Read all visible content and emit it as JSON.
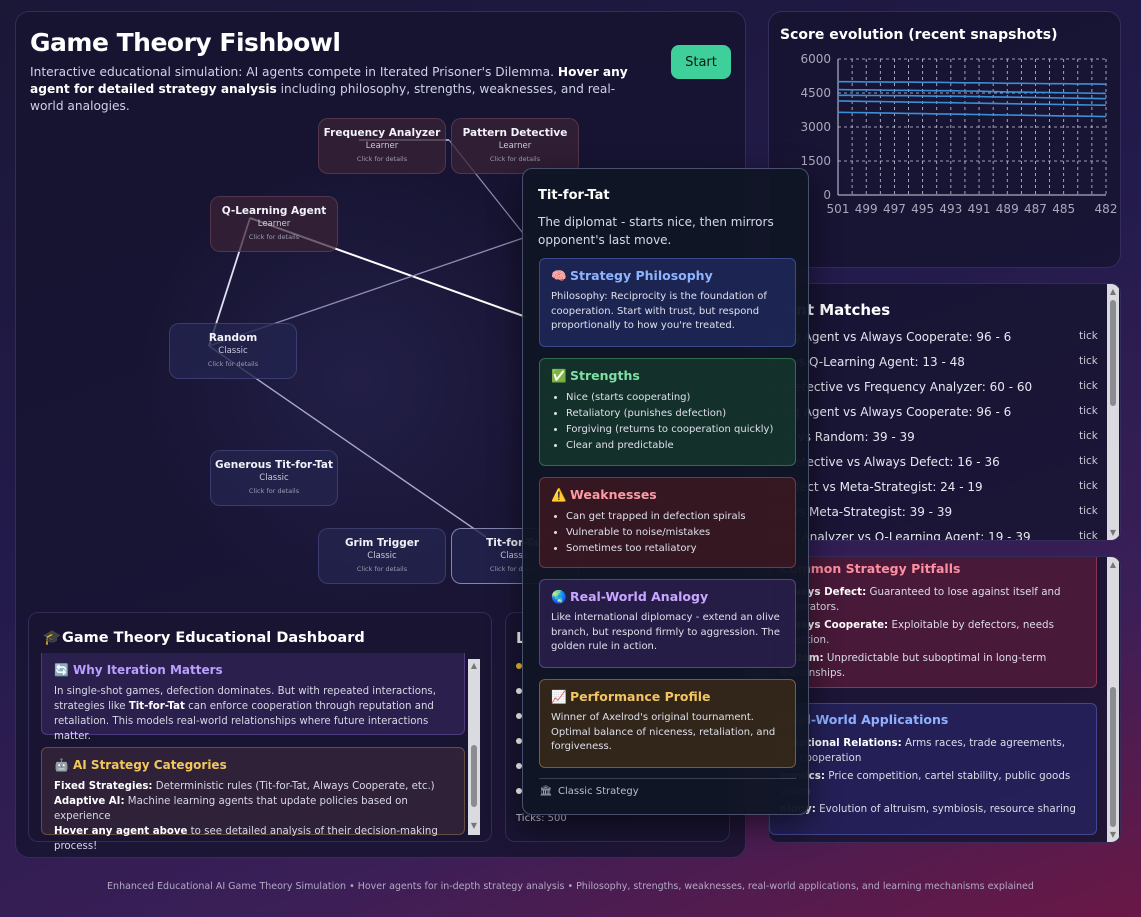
{
  "header": {
    "title": "Game Theory Fishbowl",
    "subtitle_plain": "Interactive educational simulation: AI agents compete in Iterated Prisoner's Dilemma. ",
    "subtitle_bold": "Hover any agent for detailed strategy analysis",
    "subtitle_tail": " including philosophy, strengths, weaknesses, and real-world analogies.",
    "start_label": "Start"
  },
  "agents": [
    {
      "name": "Frequency Analyzer",
      "type": "Learner",
      "hint": "Click for details"
    },
    {
      "name": "Pattern Detective",
      "type": "Learner",
      "hint": "Click for details"
    },
    {
      "name": "Q-Learning Agent",
      "type": "Learner",
      "hint": "Click for details"
    },
    {
      "name": "Random",
      "type": "Classic",
      "hint": "Click for details"
    },
    {
      "name": "Generous Tit-for-Tat",
      "type": "Classic",
      "hint": "Click for details"
    },
    {
      "name": "Grim Trigger",
      "type": "Classic",
      "hint": "Click for details"
    },
    {
      "name": "Tit-for-Tat",
      "type": "Classic",
      "hint": "Click for details"
    }
  ],
  "dashboard": {
    "title": "Game Theory Educational Dashboard",
    "title_icon": "graduation-cap-icon",
    "iteration": {
      "icon": "refresh-icon",
      "heading": "Why Iteration Matters",
      "text_a": "In single-shot games, defection dominates. But with repeated interactions, strategies like ",
      "text_bold": "Tit-for-Tat",
      "text_b": " can enforce cooperation through reputation and retaliation. This models real-world relationships where future interactions matter."
    },
    "categories": {
      "icon": "robot-icon",
      "heading": "AI Strategy Categories",
      "fixed_label": "Fixed Strategies:",
      "fixed_text": " Deterministic rules (Tit-for-Tat, Always Cooperate, etc.)",
      "adaptive_label": "Adaptive AI:",
      "adaptive_text": " Machine learning agents that update policies based on experience",
      "hover_label": "Hover any agent above",
      "hover_text": " to see detailed analysis of their decision-making process!"
    }
  },
  "leaderboard": {
    "title": "L",
    "ticks_text": "Ticks: 500"
  },
  "chart_data": {
    "type": "line",
    "title": "Score evolution (recent snapshots)",
    "x": [
      501,
      500,
      499,
      498,
      497,
      496,
      495,
      494,
      493,
      492,
      491,
      490,
      489,
      488,
      487,
      486,
      485,
      484,
      483,
      482
    ],
    "x_tick_labels": [
      "501",
      "499",
      "497",
      "495",
      "493",
      "491",
      "489",
      "487",
      "485",
      "482"
    ],
    "ylim": [
      0,
      6000
    ],
    "y_ticks": [
      0,
      1500,
      3000,
      4500,
      6000
    ],
    "grid": true,
    "color": "#3b8fd6",
    "series": [
      {
        "values": [
          5000,
          5000,
          4990,
          4990,
          4980,
          4980,
          4970,
          4970,
          4960,
          4950,
          4950,
          4940,
          4930,
          4930,
          4920,
          4910,
          4910,
          4900,
          4900,
          4890
        ]
      },
      {
        "values": [
          4650,
          4640,
          4640,
          4630,
          4620,
          4620,
          4610,
          4600,
          4600,
          4590,
          4580,
          4560,
          4550,
          4540,
          4530,
          4520,
          4510,
          4500,
          4490,
          4480
        ]
      },
      {
        "values": [
          4400,
          4400,
          4390,
          4390,
          4380,
          4380,
          4370,
          4360,
          4360,
          4350,
          4340,
          4330,
          4320,
          4310,
          4300,
          4290,
          4280,
          4270,
          4260,
          4250
        ]
      },
      {
        "values": [
          4150,
          4140,
          4130,
          4120,
          4110,
          4100,
          4090,
          4080,
          4070,
          4060,
          4050,
          4040,
          4030,
          4020,
          4010,
          4000,
          3990,
          3980,
          3970,
          3960
        ]
      },
      {
        "values": [
          3650,
          3640,
          3630,
          3620,
          3610,
          3600,
          3590,
          3580,
          3570,
          3560,
          3550,
          3540,
          3530,
          3520,
          3510,
          3500,
          3490,
          3480,
          3470,
          3460
        ]
      }
    ]
  },
  "matches": {
    "title": "ent Matches",
    "items": [
      {
        "text": "rning Agent vs Always Cooperate: 96 - 6",
        "tick": "tick"
      },
      {
        "text": "om vs Q-Learning Agent: 13 - 48",
        "tick": "tick"
      },
      {
        "text": "rn Detective vs Frequency Analyzer: 60 - 60",
        "tick": "tick"
      },
      {
        "text": "rning Agent vs Always Cooperate: 96 - 6",
        "tick": "tick"
      },
      {
        "text": "r-Tat vs Random: 39 - 39",
        "tick": "tick"
      },
      {
        "text": "rn Detective vs Always Defect: 16 - 36",
        "tick": "tick"
      },
      {
        "text": "s Defect vs Meta-Strategist: 24 - 19",
        "tick": "tick"
      },
      {
        "text": "om vs Meta-Strategist: 39 - 39",
        "tick": "tick"
      },
      {
        "text": "ency Analyzer vs Q-Learning Agent: 19 - 39",
        "tick": "tick"
      }
    ]
  },
  "pitfalls": {
    "heading": "Common Strategy Pitfalls",
    "items": [
      {
        "label": "Always Defect:",
        "text": " Guaranteed to lose against itself and",
        "cont": "ooperators."
      },
      {
        "label": "Always Cooperate:",
        "text": " Exploitable by defectors, needs",
        "cont": "rotection."
      },
      {
        "label": "andom:",
        "text": " Unpredictable but suboptimal in long-term",
        "cont": "elationships."
      }
    ]
  },
  "applications": {
    "heading": "Real-World Applications",
    "items": [
      {
        "label": "ernational Relations:",
        "text": " Arms races, trade agreements,",
        "cont": "ate cooperation"
      },
      {
        "label": "nomics:",
        "text": " Price competition, cartel stability, public goods",
        "cont": "vision"
      },
      {
        "label": "ology:",
        "text": " Evolution of altruism, symbiosis, resource sharing",
        "cont": ""
      }
    ]
  },
  "tooltip": {
    "name": "Tit-for-Tat",
    "description": "The diplomat - starts nice, then mirrors opponent's last move.",
    "philosophy": {
      "icon": "brain-icon",
      "heading": "Strategy Philosophy",
      "text": "Philosophy: Reciprocity is the foundation of cooperation. Start with trust, but respond proportionally to how you're treated."
    },
    "strengths": {
      "icon": "check-icon",
      "heading": "Strengths",
      "items": [
        "Nice (starts cooperating)",
        "Retaliatory (punishes defection)",
        "Forgiving (returns to cooperation quickly)",
        "Clear and predictable"
      ]
    },
    "weaknesses": {
      "icon": "warning-icon",
      "heading": "Weaknesses",
      "items": [
        "Can get trapped in defection spirals",
        "Vulnerable to noise/mistakes",
        "Sometimes too retaliatory"
      ]
    },
    "analogy": {
      "icon": "globe-icon",
      "heading": "Real-World Analogy",
      "text": "Like international diplomacy - extend an olive branch, but respond firmly to aggression. The golden rule in action."
    },
    "performance": {
      "icon": "chart-icon",
      "heading": "Performance Profile",
      "text": "Winner of Axelrod's original tournament. Optimal balance of niceness, retaliation, and forgiveness."
    },
    "footer_icon": "building-icon",
    "footer": "Classic Strategy"
  },
  "footer": "Enhanced Educational AI Game Theory Simulation • Hover agents for in-depth strategy analysis • Philosophy, strengths, weaknesses, real-world applications, and learning mechanisms explained"
}
